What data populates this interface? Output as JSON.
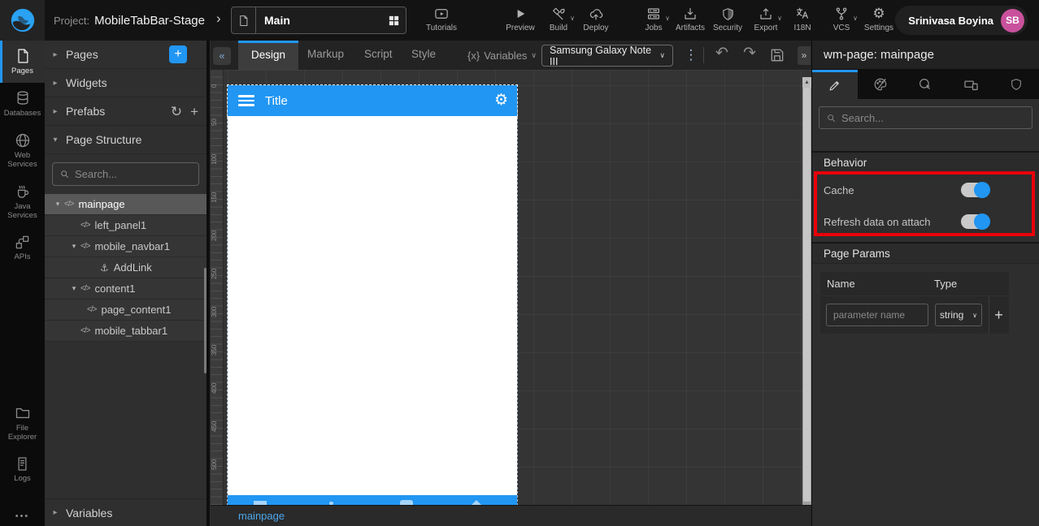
{
  "colors": {
    "accent": "#2196f3",
    "annotation_red": "#e8000a",
    "avatar_pink": "#c9519c"
  },
  "icons": {
    "caret_down": "▾",
    "caret_right": "▸",
    "chevron_down": "∨",
    "breadcrumb_chevron": "›",
    "collapse_left": "«",
    "expand_right": "»",
    "kebab": "⋮",
    "undo": "↶",
    "redo": "↷",
    "plus": "+",
    "refresh": "↻",
    "anchor": "⚓",
    "gear": "⚙",
    "braces": "{x}",
    "code": "</>",
    "more_dots": "•••",
    "scroll_up": "▲"
  },
  "topbar": {
    "project_label": "Project:",
    "project_name": "MobileTabBar-Stage",
    "page_name": "Main",
    "tools": {
      "tutorials": "Tutorials",
      "preview": "Preview",
      "build": "Build",
      "deploy": "Deploy",
      "jobs": "Jobs",
      "artifacts": "Artifacts",
      "security": "Security",
      "export": "Export",
      "i18n": "I18N",
      "vcs": "VCS",
      "settings": "Settings"
    },
    "user_name": "Srinivasa Boyina",
    "user_initials": "SB"
  },
  "sidebar": {
    "pages": "Pages",
    "databases": "Databases",
    "web_services": "Web Services",
    "java_services": "Java Services",
    "apis": "APIs",
    "file_explorer": "File Explorer",
    "logs": "Logs"
  },
  "left_panel": {
    "sections": {
      "pages": "Pages",
      "widgets": "Widgets",
      "prefabs": "Prefabs",
      "page_structure": "Page Structure",
      "variables": "Variables"
    },
    "search_placeholder": "Search...",
    "tree": [
      {
        "label": "mainpage"
      },
      {
        "label": "left_panel1"
      },
      {
        "label": "mobile_navbar1"
      },
      {
        "label": "AddLink"
      },
      {
        "label": "content1"
      },
      {
        "label": "page_content1"
      },
      {
        "label": "mobile_tabbar1"
      }
    ]
  },
  "canvas": {
    "tabs": {
      "design": "Design",
      "markup": "Markup",
      "script": "Script",
      "style": "Style"
    },
    "variables_label": "Variables",
    "device_selector": "Samsung Galaxy Note III",
    "device": {
      "navbar_title": "Title"
    },
    "page_tab": "mainpage",
    "ruler": [
      "0",
      "50",
      "100",
      "150",
      "200",
      "250",
      "300",
      "350",
      "400",
      "450",
      "500"
    ]
  },
  "right_panel": {
    "title": "wm-page: mainpage",
    "search_placeholder": "Search...",
    "behavior": {
      "header": "Behavior",
      "cache_label": "Cache",
      "refresh_label": "Refresh data on attach"
    },
    "page_params": {
      "header": "Page Params",
      "name_col": "Name",
      "type_col": "Type",
      "param_placeholder": "parameter name",
      "type_value": "string"
    }
  }
}
